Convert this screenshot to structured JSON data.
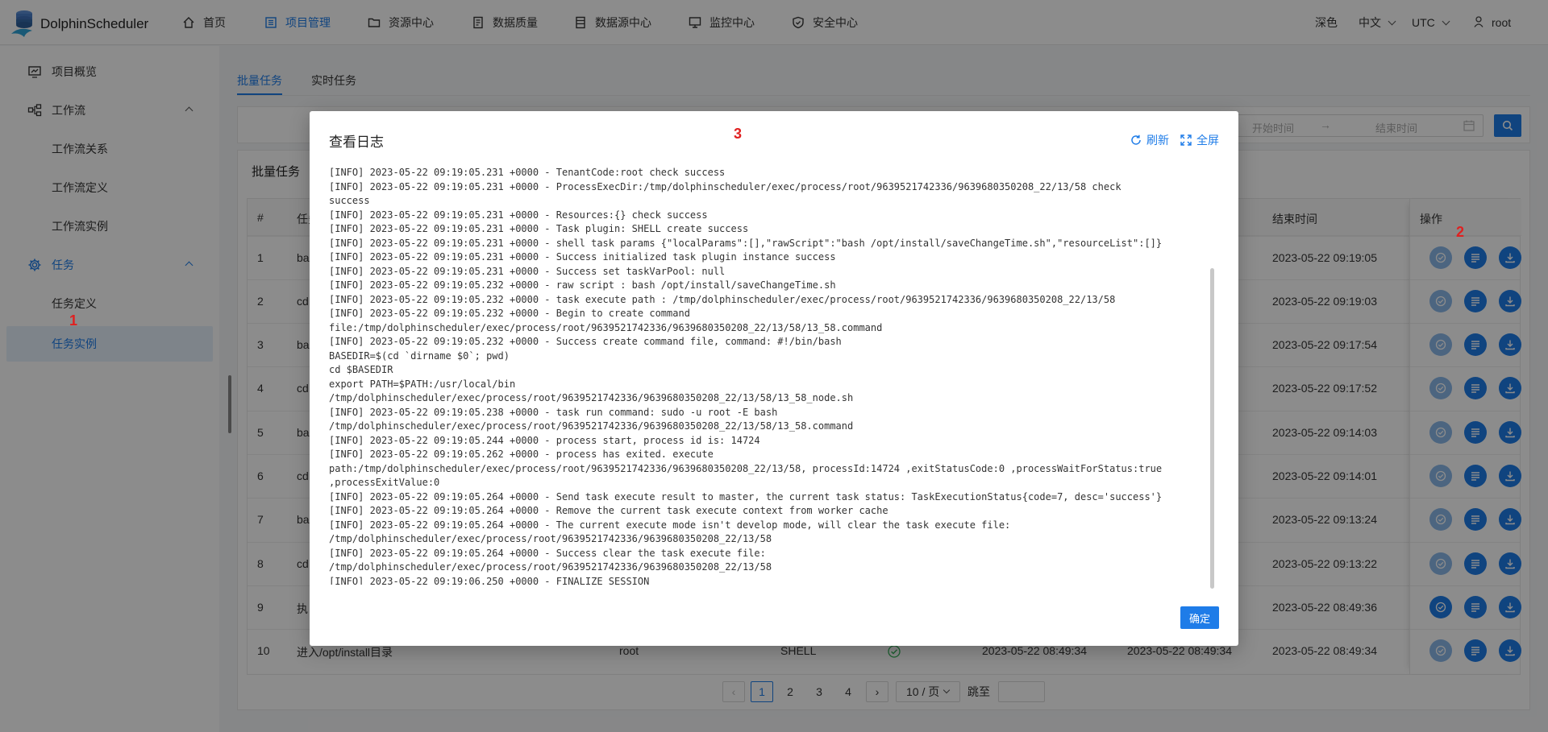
{
  "app": {
    "name": "DolphinScheduler"
  },
  "nav": [
    {
      "label": "首页",
      "icon": "home-icon"
    },
    {
      "label": "项目管理",
      "icon": "project-icon"
    },
    {
      "label": "资源中心",
      "icon": "folder-icon"
    },
    {
      "label": "数据质量",
      "icon": "data-quality-icon"
    },
    {
      "label": "数据源中心",
      "icon": "datasource-icon"
    },
    {
      "label": "监控中心",
      "icon": "monitor-icon"
    },
    {
      "label": "安全中心",
      "icon": "shield-icon"
    }
  ],
  "header_right": {
    "theme": "深色",
    "language": "中文",
    "timezone": "UTC",
    "user": "root"
  },
  "sidebar": {
    "overview": "项目概览",
    "workflow": "工作流",
    "workflow_relation": "工作流关系",
    "workflow_definition": "工作流定义",
    "workflow_instance": "工作流实例",
    "task": "任务",
    "task_definition": "任务定义",
    "task_instance": "任务实例"
  },
  "tabs": {
    "batch": "批量任务",
    "realtime": "实时任务"
  },
  "filters": {
    "start_placeholder": "开始时间",
    "end_placeholder": "结束时间"
  },
  "panel": {
    "title": "批量任务"
  },
  "table": {
    "headers": {
      "index": "#",
      "name": "任务",
      "end_time": "结束时间",
      "ops": "操作"
    },
    "rows": [
      {
        "index": "1",
        "name": "ba",
        "end_time": "2023-05-22 09:19:05"
      },
      {
        "index": "2",
        "name": "cd",
        "end_time": "2023-05-22 09:19:03"
      },
      {
        "index": "3",
        "name": "ba",
        "end_time": "2023-05-22 09:17:54"
      },
      {
        "index": "4",
        "name": "cd",
        "end_time": "2023-05-22 09:17:52"
      },
      {
        "index": "5",
        "name": "ba",
        "end_time": "2023-05-22 09:14:03"
      },
      {
        "index": "6",
        "name": "cd",
        "end_time": "2023-05-22 09:14:01"
      },
      {
        "index": "7",
        "name": "ba",
        "end_time": "2023-05-22 09:13:24"
      },
      {
        "index": "8",
        "name": "cd",
        "end_time": "2023-05-22 09:13:22"
      },
      {
        "index": "9",
        "name": "执",
        "end_time": "2023-05-22 08:49:36"
      },
      {
        "index": "10",
        "name": "进入/opt/install目录",
        "user": "root",
        "type": "SHELL",
        "start_time": "2023-05-22 08:49:34",
        "submit_time": "2023-05-22 08:49:34",
        "end_time": "2023-05-22 08:49:34"
      }
    ]
  },
  "pagination": {
    "pages": [
      "1",
      "2",
      "3",
      "4"
    ],
    "page_size": "10 / 页",
    "jump_label": "跳至"
  },
  "modal": {
    "title": "查看日志",
    "refresh": "刷新",
    "fullscreen": "全屏",
    "confirm": "确定",
    "log_lines": [
      "[INFO] 2023-05-22 09:19:05.231 +0000 - TenantCode:root check success",
      "[INFO] 2023-05-22 09:19:05.231 +0000 - ProcessExecDir:/tmp/dolphinscheduler/exec/process/root/9639521742336/9639680350208_22/13/58 check",
      "success",
      "[INFO] 2023-05-22 09:19:05.231 +0000 - Resources:{} check success",
      "[INFO] 2023-05-22 09:19:05.231 +0000 - Task plugin: SHELL create success",
      "[INFO] 2023-05-22 09:19:05.231 +0000 - shell task params {\"localParams\":[],\"rawScript\":\"bash /opt/install/saveChangeTime.sh\",\"resourceList\":[]}",
      "[INFO] 2023-05-22 09:19:05.231 +0000 - Success initialized task plugin instance success",
      "[INFO] 2023-05-22 09:19:05.231 +0000 - Success set taskVarPool: null",
      "[INFO] 2023-05-22 09:19:05.232 +0000 - raw script : bash /opt/install/saveChangeTime.sh",
      "[INFO] 2023-05-22 09:19:05.232 +0000 - task execute path : /tmp/dolphinscheduler/exec/process/root/9639521742336/9639680350208_22/13/58",
      "[INFO] 2023-05-22 09:19:05.232 +0000 - Begin to create command",
      "file:/tmp/dolphinscheduler/exec/process/root/9639521742336/9639680350208_22/13/58/13_58.command",
      "[INFO] 2023-05-22 09:19:05.232 +0000 - Success create command file, command: #!/bin/bash",
      "BASEDIR=$(cd `dirname $0`; pwd)",
      "cd $BASEDIR",
      "export PATH=$PATH:/usr/local/bin",
      "/tmp/dolphinscheduler/exec/process/root/9639521742336/9639680350208_22/13/58/13_58_node.sh",
      "[INFO] 2023-05-22 09:19:05.238 +0000 - task run command: sudo -u root -E bash",
      "/tmp/dolphinscheduler/exec/process/root/9639521742336/9639680350208_22/13/58/13_58.command",
      "[INFO] 2023-05-22 09:19:05.244 +0000 - process start, process id is: 14724",
      "[INFO] 2023-05-22 09:19:05.262 +0000 - process has exited. execute",
      "path:/tmp/dolphinscheduler/exec/process/root/9639521742336/9639680350208_22/13/58, processId:14724 ,exitStatusCode:0 ,processWaitForStatus:true",
      ",processExitValue:0",
      "[INFO] 2023-05-22 09:19:05.264 +0000 - Send task execute result to master, the current task status: TaskExecutionStatus{code=7, desc='success'}",
      "[INFO] 2023-05-22 09:19:05.264 +0000 - Remove the current task execute context from worker cache",
      "[INFO] 2023-05-22 09:19:05.264 +0000 - The current execute mode isn't develop mode, will clear the task execute file:",
      "/tmp/dolphinscheduler/exec/process/root/9639521742336/9639680350208_22/13/58",
      "[INFO] 2023-05-22 09:19:05.264 +0000 - Success clear the task execute file:",
      "/tmp/dolphinscheduler/exec/process/root/9639521742336/9639680350208_22/13/58",
      "[INFO] 2023-05-22 09:19:06.250 +0000 - FINALIZE_SESSION"
    ]
  },
  "annotations": {
    "marker1": "1",
    "marker2": "2",
    "marker3": "3"
  }
}
